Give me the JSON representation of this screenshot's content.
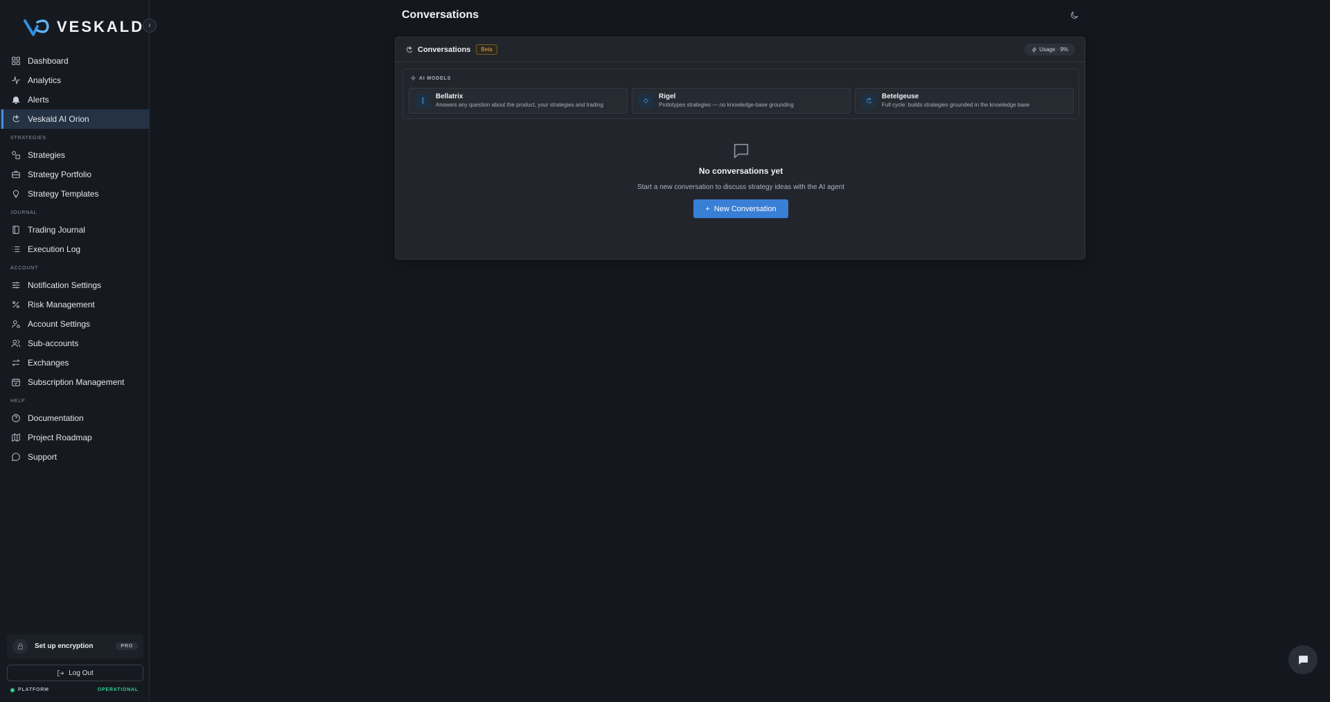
{
  "brand": {
    "name": "VESKALD"
  },
  "sidebar": {
    "main_items": [
      {
        "label": "Dashboard",
        "icon": "grid-icon"
      },
      {
        "label": "Analytics",
        "icon": "activity-icon"
      },
      {
        "label": "Alerts",
        "icon": "bell-icon"
      },
      {
        "label": "Veskald AI Orion",
        "icon": "orion-icon",
        "active": true
      }
    ],
    "sections": [
      {
        "title": "STRATEGIES",
        "items": [
          {
            "label": "Strategies",
            "icon": "shapes-icon"
          },
          {
            "label": "Strategy Portfolio",
            "icon": "briefcase-icon"
          },
          {
            "label": "Strategy Templates",
            "icon": "lightbulb-icon"
          }
        ]
      },
      {
        "title": "JOURNAL",
        "items": [
          {
            "label": "Trading Journal",
            "icon": "notebook-icon"
          },
          {
            "label": "Execution Log",
            "icon": "list-icon"
          }
        ]
      },
      {
        "title": "ACCOUNT",
        "items": [
          {
            "label": "Notification Settings",
            "icon": "sliders-icon"
          },
          {
            "label": "Risk Management",
            "icon": "percent-icon"
          },
          {
            "label": "Account Settings",
            "icon": "user-cog-icon"
          },
          {
            "label": "Sub-accounts",
            "icon": "users-icon"
          },
          {
            "label": "Exchanges",
            "icon": "arrows-swap-icon"
          },
          {
            "label": "Subscription Management",
            "icon": "calendar-check-icon"
          }
        ]
      },
      {
        "title": "HELP",
        "items": [
          {
            "label": "Documentation",
            "icon": "help-circle-icon"
          },
          {
            "label": "Project Roadmap",
            "icon": "map-icon"
          },
          {
            "label": "Support",
            "icon": "message-circle-icon"
          }
        ]
      }
    ],
    "encryption": {
      "label": "Set up encryption",
      "badge": "PRO"
    },
    "logout_label": "Log Out",
    "status": {
      "left": "PLATFORM",
      "right": "OPERATIONAL"
    }
  },
  "header": {
    "title": "Conversations"
  },
  "panel": {
    "title": "Conversations",
    "badge": "Beta",
    "usage": "Usage · 9%",
    "models_label": "AI MODELS",
    "models": [
      {
        "name": "Bellatrix",
        "desc": "Answers any question about the product, your strategies and trading"
      },
      {
        "name": "Rigel",
        "desc": "Prototypes strategies — no knowledge-base grounding"
      },
      {
        "name": "Betelgeuse",
        "desc": "Full cycle: builds strategies grounded in the knowledge base"
      }
    ],
    "empty": {
      "title": "No conversations yet",
      "desc": "Start a new conversation to discuss strategy ideas with the AI agent",
      "button": "New Conversation"
    }
  },
  "colors": {
    "accent": "#3a7fd6",
    "operational": "#2ecc8f",
    "beta": "#e0a442"
  }
}
